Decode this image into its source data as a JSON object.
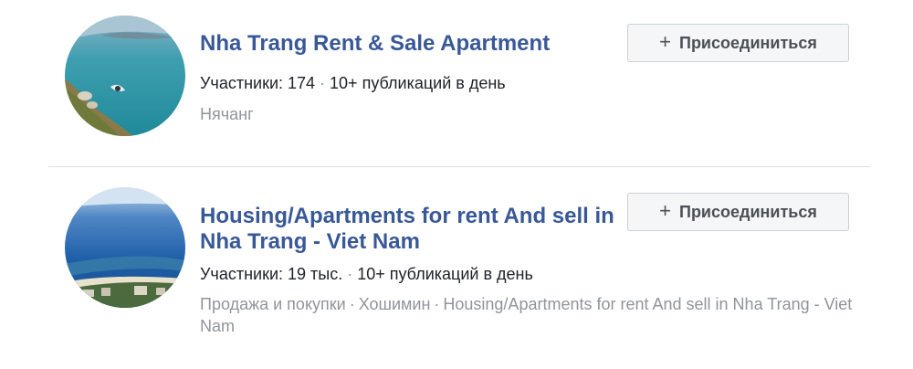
{
  "groups": [
    {
      "name": "Nha Trang Rent & Sale Apartment",
      "members": "Участники: 174",
      "posts": "10+ публикаций в день",
      "details": [
        "Нячанг"
      ],
      "join_label": "Присоединиться",
      "join_icon": "+"
    },
    {
      "name": "Housing/Apartments for rent And sell in Nha Trang - Viet Nam",
      "members": "Участники: 19 тыс.",
      "posts": "10+ публикаций в день",
      "details": [
        "Продажа и покупки",
        "Хошимин",
        "Housing/Apartments for rent And sell in Nha Trang - Viet Nam"
      ],
      "join_label": "Присоединиться",
      "join_icon": "+"
    }
  ],
  "separator": "·",
  "colors": {
    "title": "#385898",
    "meta": "#1d2129",
    "secondary": "#90949c",
    "button_bg": "#f5f6f7",
    "button_border": "#ccd0d5",
    "divider": "#dddfe2"
  }
}
